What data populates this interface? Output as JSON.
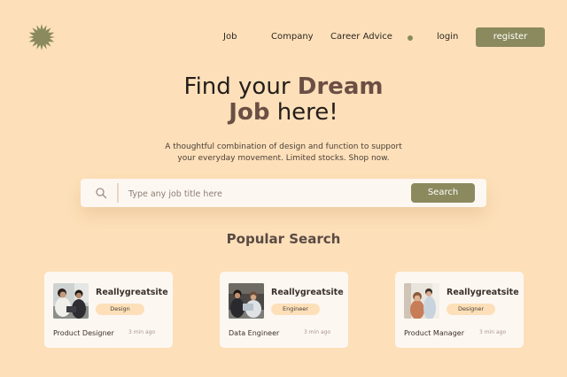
{
  "nav": {
    "links": [
      "Job",
      "Company",
      "Career Advice",
      "login"
    ],
    "register_label": "register"
  },
  "hero": {
    "title_line1_plain": "Find your",
    "title_line1_bold": "Dream",
    "title_line2_bold": "Job",
    "title_line2_plain": "here!",
    "subtitle_line1": "A thoughtful combination of design and function to support",
    "subtitle_line2": "your everyday movement. Limited stocks. Shop now."
  },
  "search": {
    "placeholder": "Type any job title here",
    "button_label": "Search",
    "icon": "search-icon"
  },
  "popular": {
    "heading": "Popular Search",
    "cards": [
      {
        "company": "Reallygreatsite",
        "tag": "Design",
        "title": "Product Designer",
        "time": "3 min ago"
      },
      {
        "company": "Reallygreatsite",
        "tag": "Engineer",
        "title": "Data Engineer",
        "time": "3 min ago"
      },
      {
        "company": "Reallygreatsite",
        "tag": "Designer",
        "title": "Product Manager",
        "time": "3 min ago"
      }
    ]
  },
  "colors": {
    "background": "#fde0b9",
    "accent": "#8a8a5e",
    "card": "#fdf7f2",
    "heading_brown": "#6b4f45"
  }
}
